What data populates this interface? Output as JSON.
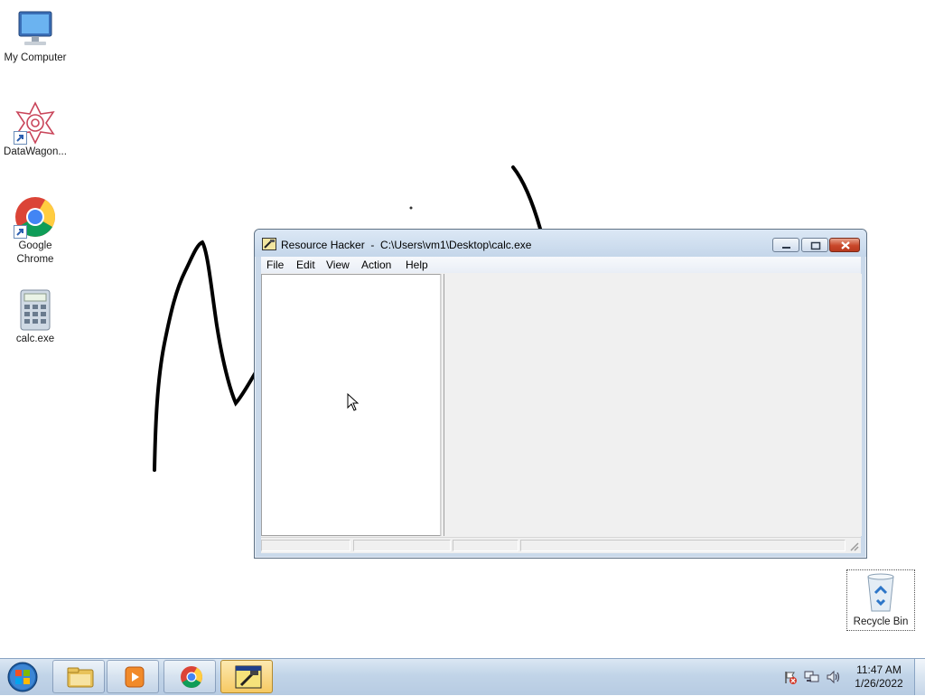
{
  "desktop": {
    "icons": [
      {
        "label": "My Computer",
        "icon": "computer-icon"
      },
      {
        "label": "DataWagon...",
        "icon": "datawagon-icon"
      },
      {
        "label": "Google Chrome",
        "icon": "chrome-icon"
      },
      {
        "label": "calc.exe",
        "icon": "calculator-icon"
      },
      {
        "label": "Recycle Bin",
        "icon": "recycle-bin-icon"
      }
    ]
  },
  "window": {
    "title": "Resource Hacker  -  C:\\Users\\vm1\\Desktop\\calc.exe",
    "menu": [
      "File",
      "Edit",
      "View",
      "Action",
      "Help"
    ]
  },
  "taskbar": {
    "items": [
      "start-orb-icon",
      "explorer-icon",
      "media-player-icon",
      "chrome-icon",
      "resource-hacker-icon"
    ],
    "tray": [
      "action-center-flag-icon",
      "network-icon",
      "volume-icon"
    ],
    "time": "11:47 AM",
    "date": "1/26/2022"
  },
  "colors": {
    "window_frame": "#cad9ea",
    "taskbar": "#c1d4e8",
    "close_button": "#c9472a"
  }
}
